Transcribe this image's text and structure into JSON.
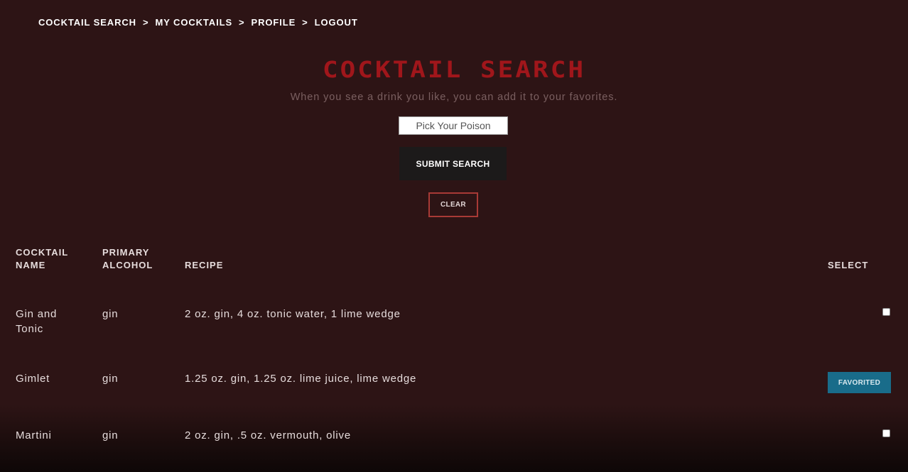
{
  "nav": {
    "items": [
      "COCKTAIL SEARCH",
      "MY COCKTAILS",
      "PROFILE",
      "LOGOUT"
    ],
    "separator": ">"
  },
  "header": {
    "title": "COCKTAIL SEARCH",
    "subtitle": "When you see a drink you like, you can add it to your favorites."
  },
  "search": {
    "placeholder": "Pick Your Poison",
    "value": "",
    "submit_label": "SUBMIT SEARCH",
    "clear_label": "CLEAR"
  },
  "table": {
    "columns": {
      "name": [
        "COCKTAIL",
        "NAME"
      ],
      "alcohol": [
        "PRIMARY",
        "ALCOHOL"
      ],
      "recipe": "RECIPE",
      "select": "SELECT"
    },
    "rows": [
      {
        "name": [
          "Gin and",
          "Tonic"
        ],
        "alcohol": "gin",
        "recipe": "2 oz. gin, 4 oz. tonic water, 1 lime wedge",
        "select": "checkbox",
        "checked": false
      },
      {
        "name": [
          "Gimlet"
        ],
        "alcohol": "gin",
        "recipe": "1.25 oz. gin, 1.25 oz. lime juice, lime wedge",
        "select": "button",
        "select_label": "FAVORITED"
      },
      {
        "name": [
          "Martini"
        ],
        "alcohol": "gin",
        "recipe": "2 oz. gin, .5 oz. vermouth, olive",
        "select": "checkbox",
        "checked": false
      }
    ]
  },
  "colors": {
    "background": "#2d1415",
    "title": "#a0161b",
    "clear_border": "#a83a36",
    "favorited": "#196c8a",
    "submit": "#1c1a1a"
  }
}
